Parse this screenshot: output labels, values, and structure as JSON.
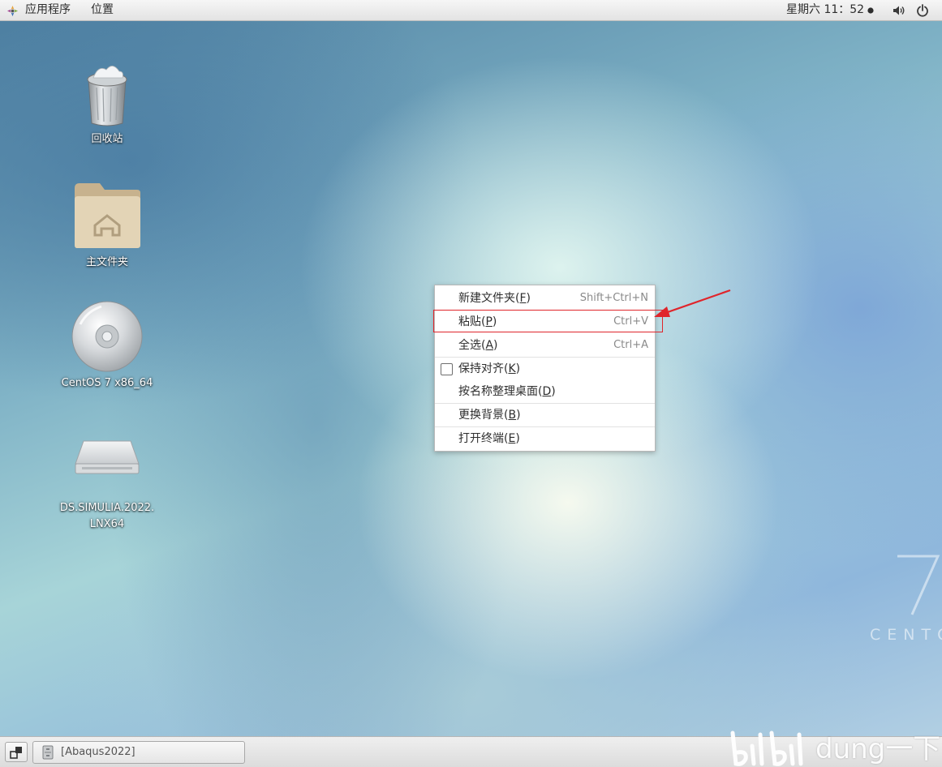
{
  "top_bar": {
    "applications_label": "应用程序",
    "places_label": "位置",
    "clock": "星期六 11：52",
    "icons": [
      "apps-icon",
      "volume-icon",
      "power-icon",
      "clock-dot-icon"
    ]
  },
  "desktop": {
    "icons": [
      {
        "label": "回收站",
        "icon": "trash-icon"
      },
      {
        "label": "主文件夹",
        "icon": "home-folder-icon"
      },
      {
        "label": "CentOS 7 x86_64",
        "icon": "disc-icon"
      },
      {
        "label": "DS.SIMULIA.2022.\nLNX64",
        "label_line1": "DS.SIMULIA.2022.",
        "label_line2": "LNX64",
        "icon": "drive-icon"
      }
    ]
  },
  "context_menu": {
    "items": [
      {
        "label": "新建文件夹",
        "mnemonic": "F",
        "accel": "Shift+Ctrl+N"
      },
      {
        "label": "粘贴",
        "mnemonic": "P",
        "accel": "Ctrl+V"
      },
      {
        "label": "全选",
        "mnemonic": "A",
        "accel": "Ctrl+A"
      },
      {
        "label": "保持对齐",
        "mnemonic": "K",
        "accel": "",
        "checkbox": false
      },
      {
        "label": "按名称整理桌面",
        "mnemonic": "D",
        "accel": ""
      },
      {
        "label": "更换背景",
        "mnemonic": "B",
        "accel": ""
      },
      {
        "label": "打开终端",
        "mnemonic": "E",
        "accel": ""
      }
    ]
  },
  "annotation": {
    "highlight_color": "#e0252b"
  },
  "bottom_bar": {
    "taskbar_item": "[Abaqus2022]"
  },
  "branding": {
    "version": "7",
    "word": "CENTOS",
    "word_visible": "CENTO"
  },
  "watermark": {
    "text": "dung一下",
    "logo": "bilibili"
  }
}
